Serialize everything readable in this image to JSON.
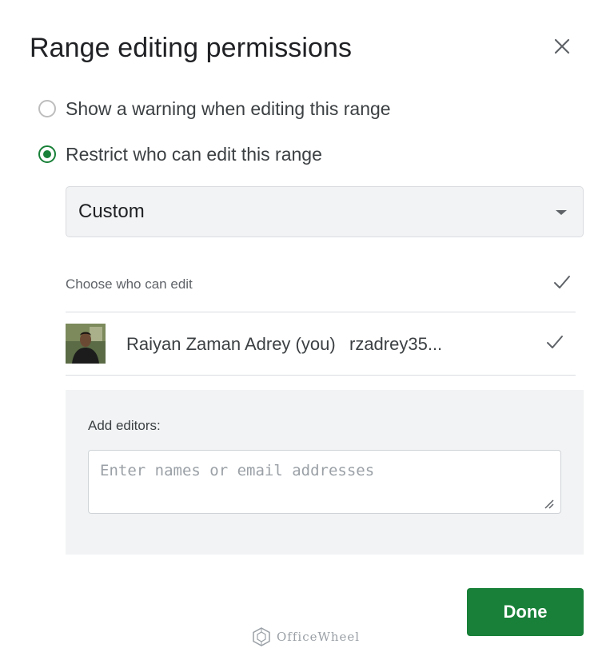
{
  "dialog": {
    "title": "Range editing permissions",
    "close_icon": "close-icon"
  },
  "options": [
    {
      "label": "Show a warning when editing this range",
      "selected": false
    },
    {
      "label": "Restrict who can edit this range",
      "selected": true
    }
  ],
  "restriction": {
    "selected_value": "Custom"
  },
  "editors": {
    "header_label": "Choose who can edit",
    "users": [
      {
        "name": "Raiyan Zaman Adrey (you)",
        "email": "rzadrey35...",
        "checked": true
      }
    ]
  },
  "add_editors": {
    "label": "Add editors:",
    "placeholder": "Enter names or email addresses"
  },
  "actions": {
    "done_label": "Done"
  },
  "watermark": {
    "text": "OfficeWheel"
  },
  "colors": {
    "accent": "#188038",
    "panel_bg": "#f1f3f4"
  }
}
